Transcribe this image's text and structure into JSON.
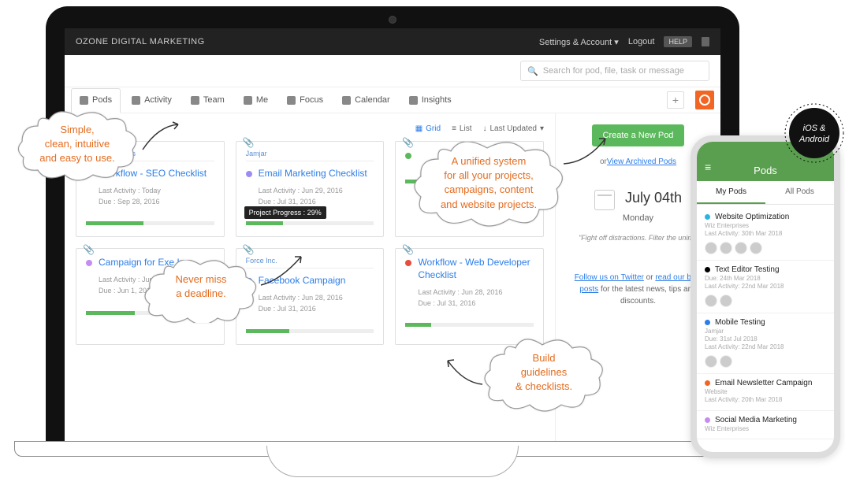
{
  "brand": "OZONE DIGITAL MARKETING",
  "header": {
    "settings_label": "Settings & Account",
    "logout_label": "Logout",
    "help_label": "HELP"
  },
  "search": {
    "placeholder": "Search for pod, file, task or message"
  },
  "tabs": {
    "pods": "Pods",
    "activity": "Activity",
    "team": "Team",
    "me": "Me",
    "focus": "Focus",
    "calendar": "Calendar",
    "insights": "Insights"
  },
  "view_toolbar": {
    "grid": "Grid",
    "list": "List",
    "sort": "Last Updated"
  },
  "cards": [
    {
      "org": "Wiz Enterprises",
      "dot": "#c58cf2",
      "title": "Workflow - SEO Checklist",
      "activity": "Last Activity : Today",
      "due": "Due : Sep 28, 2016",
      "progress": 45
    },
    {
      "org": "Jamjar",
      "dot": "#9b8cf2",
      "title": "Email Marketing Checklist",
      "activity": "Last Activity : Jun 29, 2016",
      "due": "Due : Jul 31, 2016",
      "progress": 29,
      "tooltip": "Project Progress : 29%"
    },
    {
      "org": "",
      "dot": "#5cb85c",
      "title": "",
      "activity": "",
      "due": "",
      "progress": 50
    },
    {
      "org": "",
      "dot": "#c58cf2",
      "title": "Campaign for Exe Inc.",
      "activity": "Last Activity : Jun 28, 2016",
      "due": "Due : Jun 1, 2017",
      "progress": 38
    },
    {
      "org": "Force Inc.",
      "dot": "#2b7de9",
      "title": "Facebook Campaign",
      "activity": "Last Activity : Jun 28, 2016",
      "due": "Due : Jul 31, 2016",
      "progress": 34
    },
    {
      "org": "",
      "dot": "#e74c3c",
      "title": "Workflow - Web Developer Checklist",
      "activity": "Last Activity : Jun 28, 2016",
      "due": "Due : Jul 31, 2016",
      "progress": 20
    }
  ],
  "sidebar": {
    "new_pod": "Create a New Pod",
    "archived": "View Archived Pods",
    "date_big": "July 04th",
    "date_day": "Monday",
    "quote": "\"Fight off distractions. Filter the unimp",
    "promo_pre": "Follow us on Twitter",
    "promo_mid": " or ",
    "promo_link2": "read our blog posts",
    "promo_post": " for the latest news, tips and discounts."
  },
  "callouts": {
    "c1": "Simple,\nclean, intuitive\nand easy to use.",
    "c2": "A unified system\nfor all your projects,\ncampaigns, content\nand website projects.",
    "c3": "Never miss\na deadline.",
    "c4": "Build\nguidelines\n& checklists."
  },
  "phone": {
    "title": "Pods",
    "tab_my": "My Pods",
    "tab_all": "All Pods",
    "items": [
      {
        "dot": "#2bb4e0",
        "title": "Website Optimization",
        "sub": "Wiz Enterprises",
        "meta": "Last Activity: 30th Mar 2018",
        "avatars": 4
      },
      {
        "dot": "#000000",
        "title": "Text Editor Testing",
        "sub": "",
        "meta": "Due: 24th Mar 2018\nLast Activity: 22nd Mar 2018",
        "avatars": 2
      },
      {
        "dot": "#2b7de9",
        "title": "Mobile Testing",
        "sub": "Jamjar",
        "meta": "Due: 31st Jul 2018\nLast Activity: 22nd Mar 2018",
        "avatars": 2
      },
      {
        "dot": "#f26522",
        "title": "Email Newsletter Campaign",
        "sub": "Website",
        "meta": "Last Activity: 20th Mar 2018",
        "avatars": 0
      },
      {
        "dot": "#c58cf2",
        "title": "Social Media Marketing",
        "sub": "Wiz Enterprises",
        "meta": "",
        "avatars": 0
      }
    ]
  },
  "badge_text": "iOS & Android"
}
